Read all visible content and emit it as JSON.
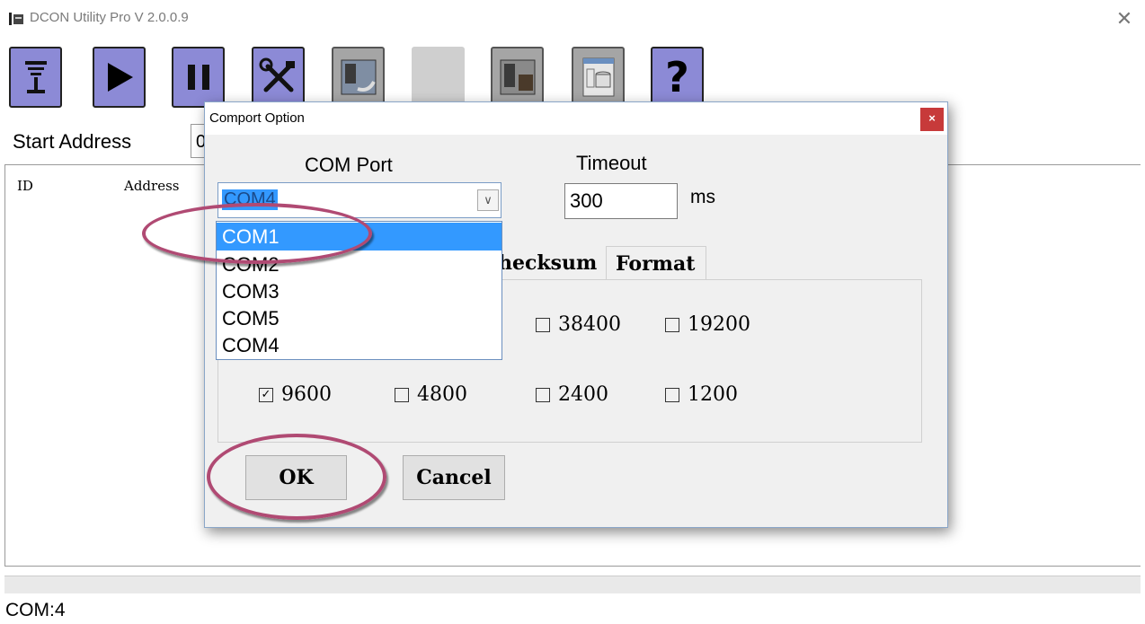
{
  "window": {
    "title": "DCON Utility Pro V 2.0.0.9",
    "close_glyph": "✕"
  },
  "toolbar": {
    "buttons": [
      {
        "name": "search-button",
        "icon": "antenna-icon"
      },
      {
        "name": "start-button",
        "icon": "play-icon",
        "glyph": "▶"
      },
      {
        "name": "pause-button",
        "icon": "pause-icon",
        "glyph": "❚❚"
      },
      {
        "name": "settings-button",
        "icon": "tools-icon",
        "glyph": "⚒"
      },
      {
        "name": "module-button",
        "icon": "module-icon"
      },
      {
        "name": "blank-button",
        "icon": "blank-icon"
      },
      {
        "name": "device-button",
        "icon": "device-icon"
      },
      {
        "name": "database-button",
        "icon": "database-icon"
      },
      {
        "name": "help-button",
        "icon": "help-icon",
        "glyph": "?"
      }
    ]
  },
  "start_address": {
    "label": "Start Address",
    "value": "0"
  },
  "list": {
    "columns": [
      "ID",
      "Address"
    ]
  },
  "status_bar": {
    "text": "COM:4"
  },
  "dialog": {
    "title": "Comport Option",
    "close_glyph": "×",
    "com_port": {
      "label": "COM Port",
      "selected": "COM4",
      "options": [
        "COM1",
        "COM2",
        "COM3",
        "COM5",
        "COM4"
      ],
      "highlighted": "COM1"
    },
    "timeout": {
      "label": "Timeout",
      "value": "300",
      "unit": "ms"
    },
    "tabs": [
      "hecksum",
      "Format"
    ],
    "baud_rates": [
      {
        "value": "38400",
        "checked": false
      },
      {
        "value": "19200",
        "checked": false
      },
      {
        "value": "9600",
        "checked": true
      },
      {
        "value": "4800",
        "checked": false
      },
      {
        "value": "2400",
        "checked": false
      },
      {
        "value": "1200",
        "checked": false
      }
    ],
    "ok_label": "OK",
    "cancel_label": "Cancel"
  },
  "colors": {
    "accent": "#3399ff",
    "annotation": "#b04a73",
    "toolbar_button": "#8c8ad6"
  }
}
